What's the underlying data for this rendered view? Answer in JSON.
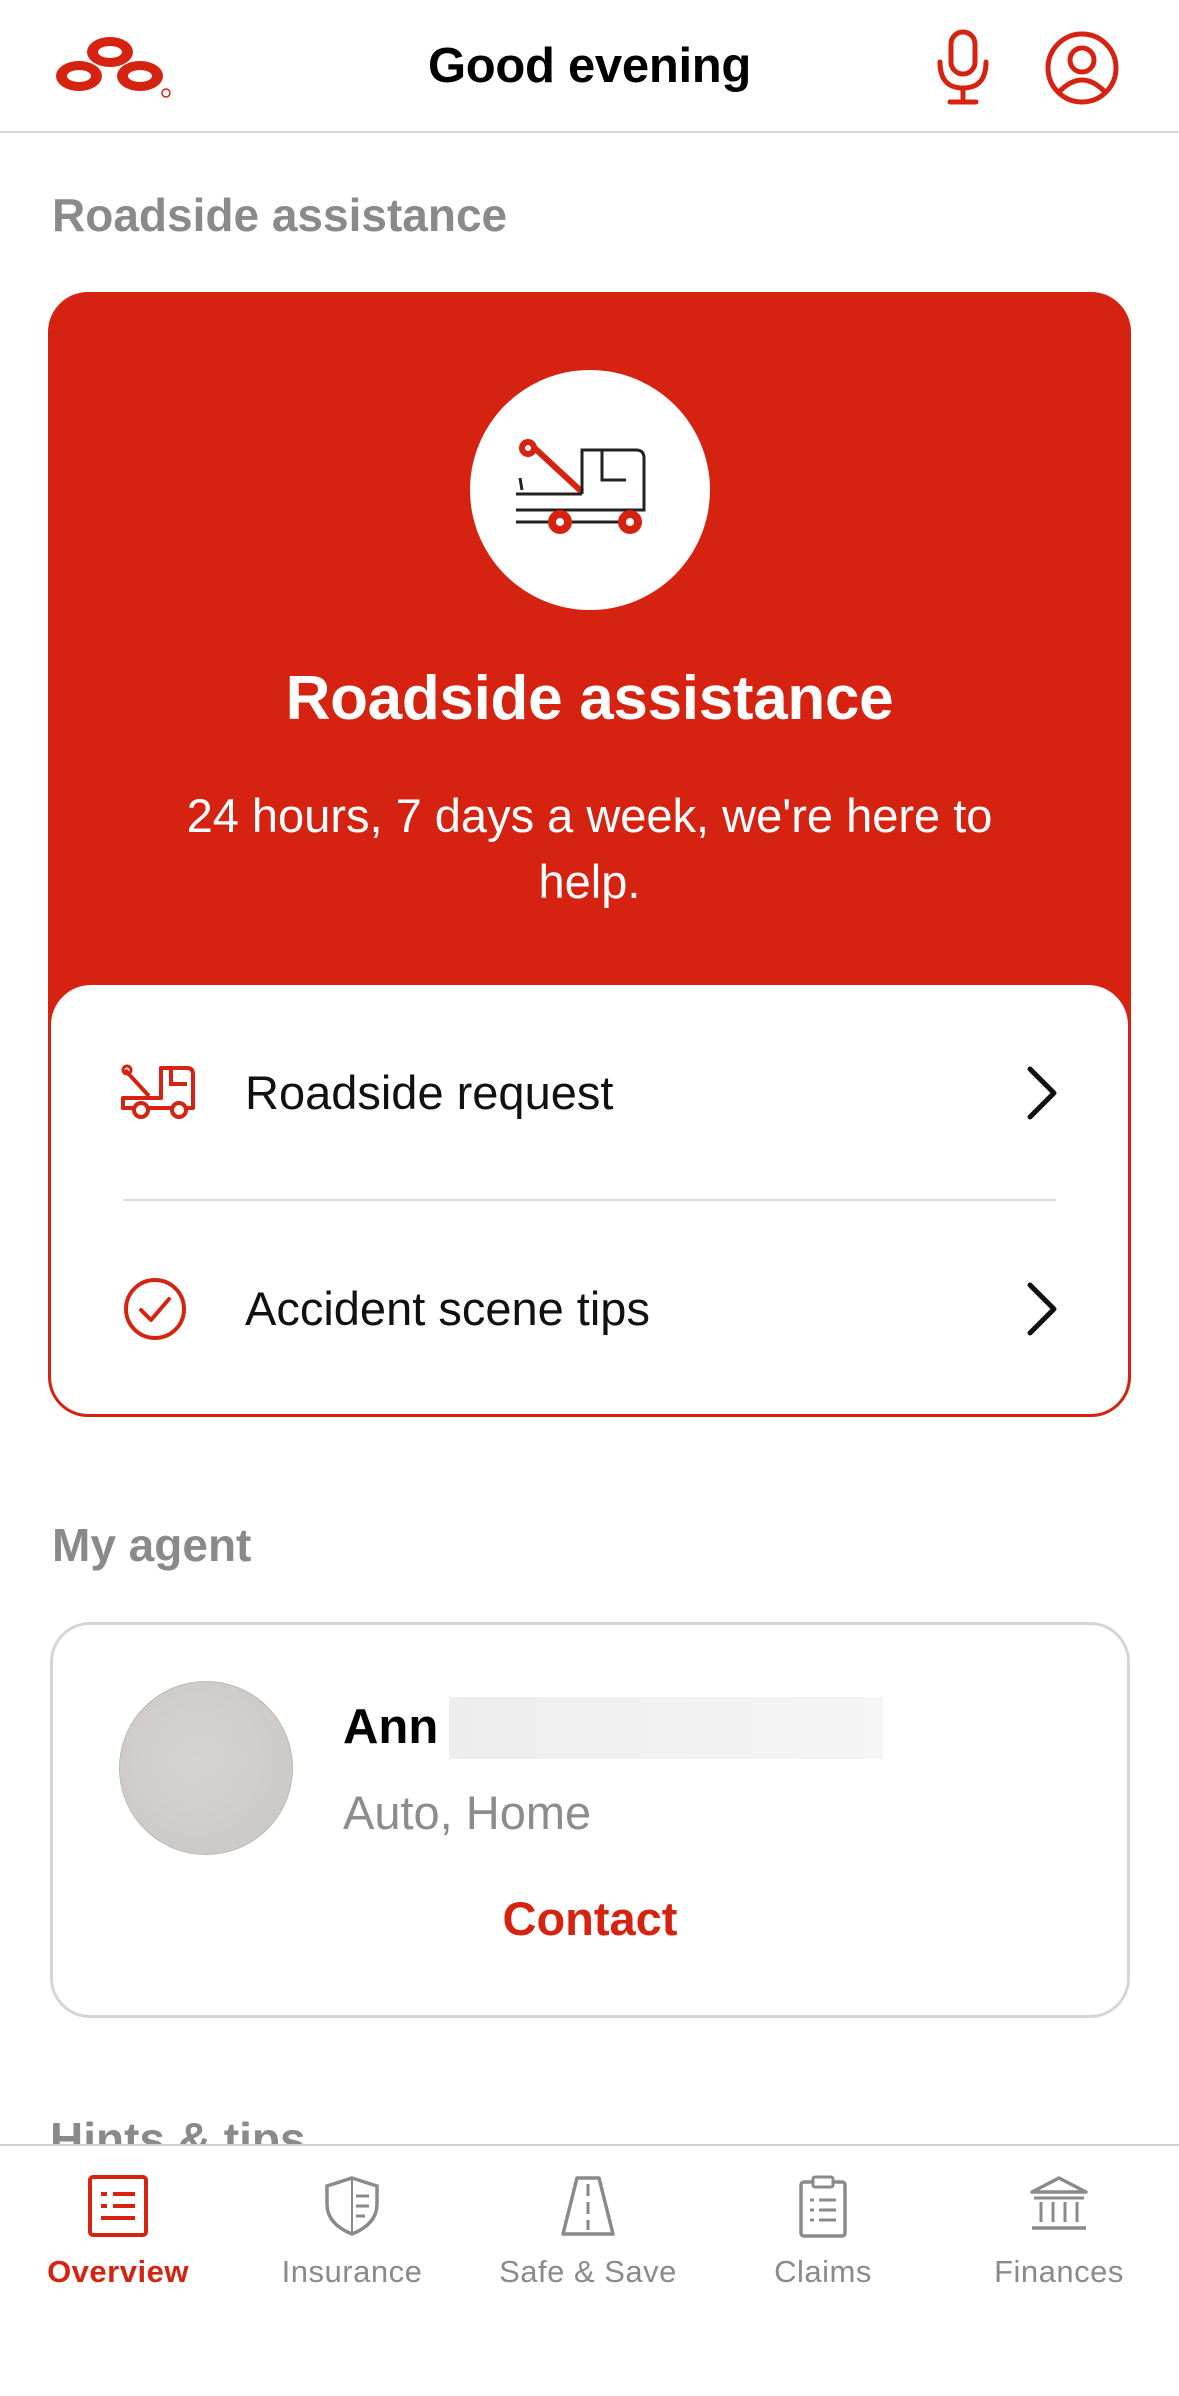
{
  "header": {
    "greeting": "Good evening",
    "logo_icon": "state-farm-logo-icon",
    "mic_icon": "microphone-icon",
    "profile_icon": "profile-icon"
  },
  "colors": {
    "brand": "#d62311",
    "muted": "#8a8a8a"
  },
  "roadside_section": {
    "heading": "Roadside assistance",
    "card": {
      "title": "Roadside assistance",
      "subtitle": "24 hours, 7 days a week, we're here to help.",
      "icon": "tow-truck-icon",
      "options": [
        {
          "label": "Roadside request",
          "icon": "tow-truck-small-icon"
        },
        {
          "label": "Accident scene tips",
          "icon": "check-circle-icon"
        }
      ]
    }
  },
  "agent_section": {
    "heading": "My agent",
    "agent": {
      "name": "Ann",
      "lines": "Auto, Home",
      "contact_label": "Contact"
    }
  },
  "hints_section": {
    "heading": "Hints & tips"
  },
  "tabbar": {
    "tabs": [
      {
        "label": "Overview",
        "icon": "overview-icon",
        "active": true
      },
      {
        "label": "Insurance",
        "icon": "shield-icon",
        "active": false
      },
      {
        "label": "Safe & Save",
        "icon": "road-icon",
        "active": false
      },
      {
        "label": "Claims",
        "icon": "clipboard-icon",
        "active": false
      },
      {
        "label": "Finances",
        "icon": "bank-icon",
        "active": false
      }
    ]
  }
}
